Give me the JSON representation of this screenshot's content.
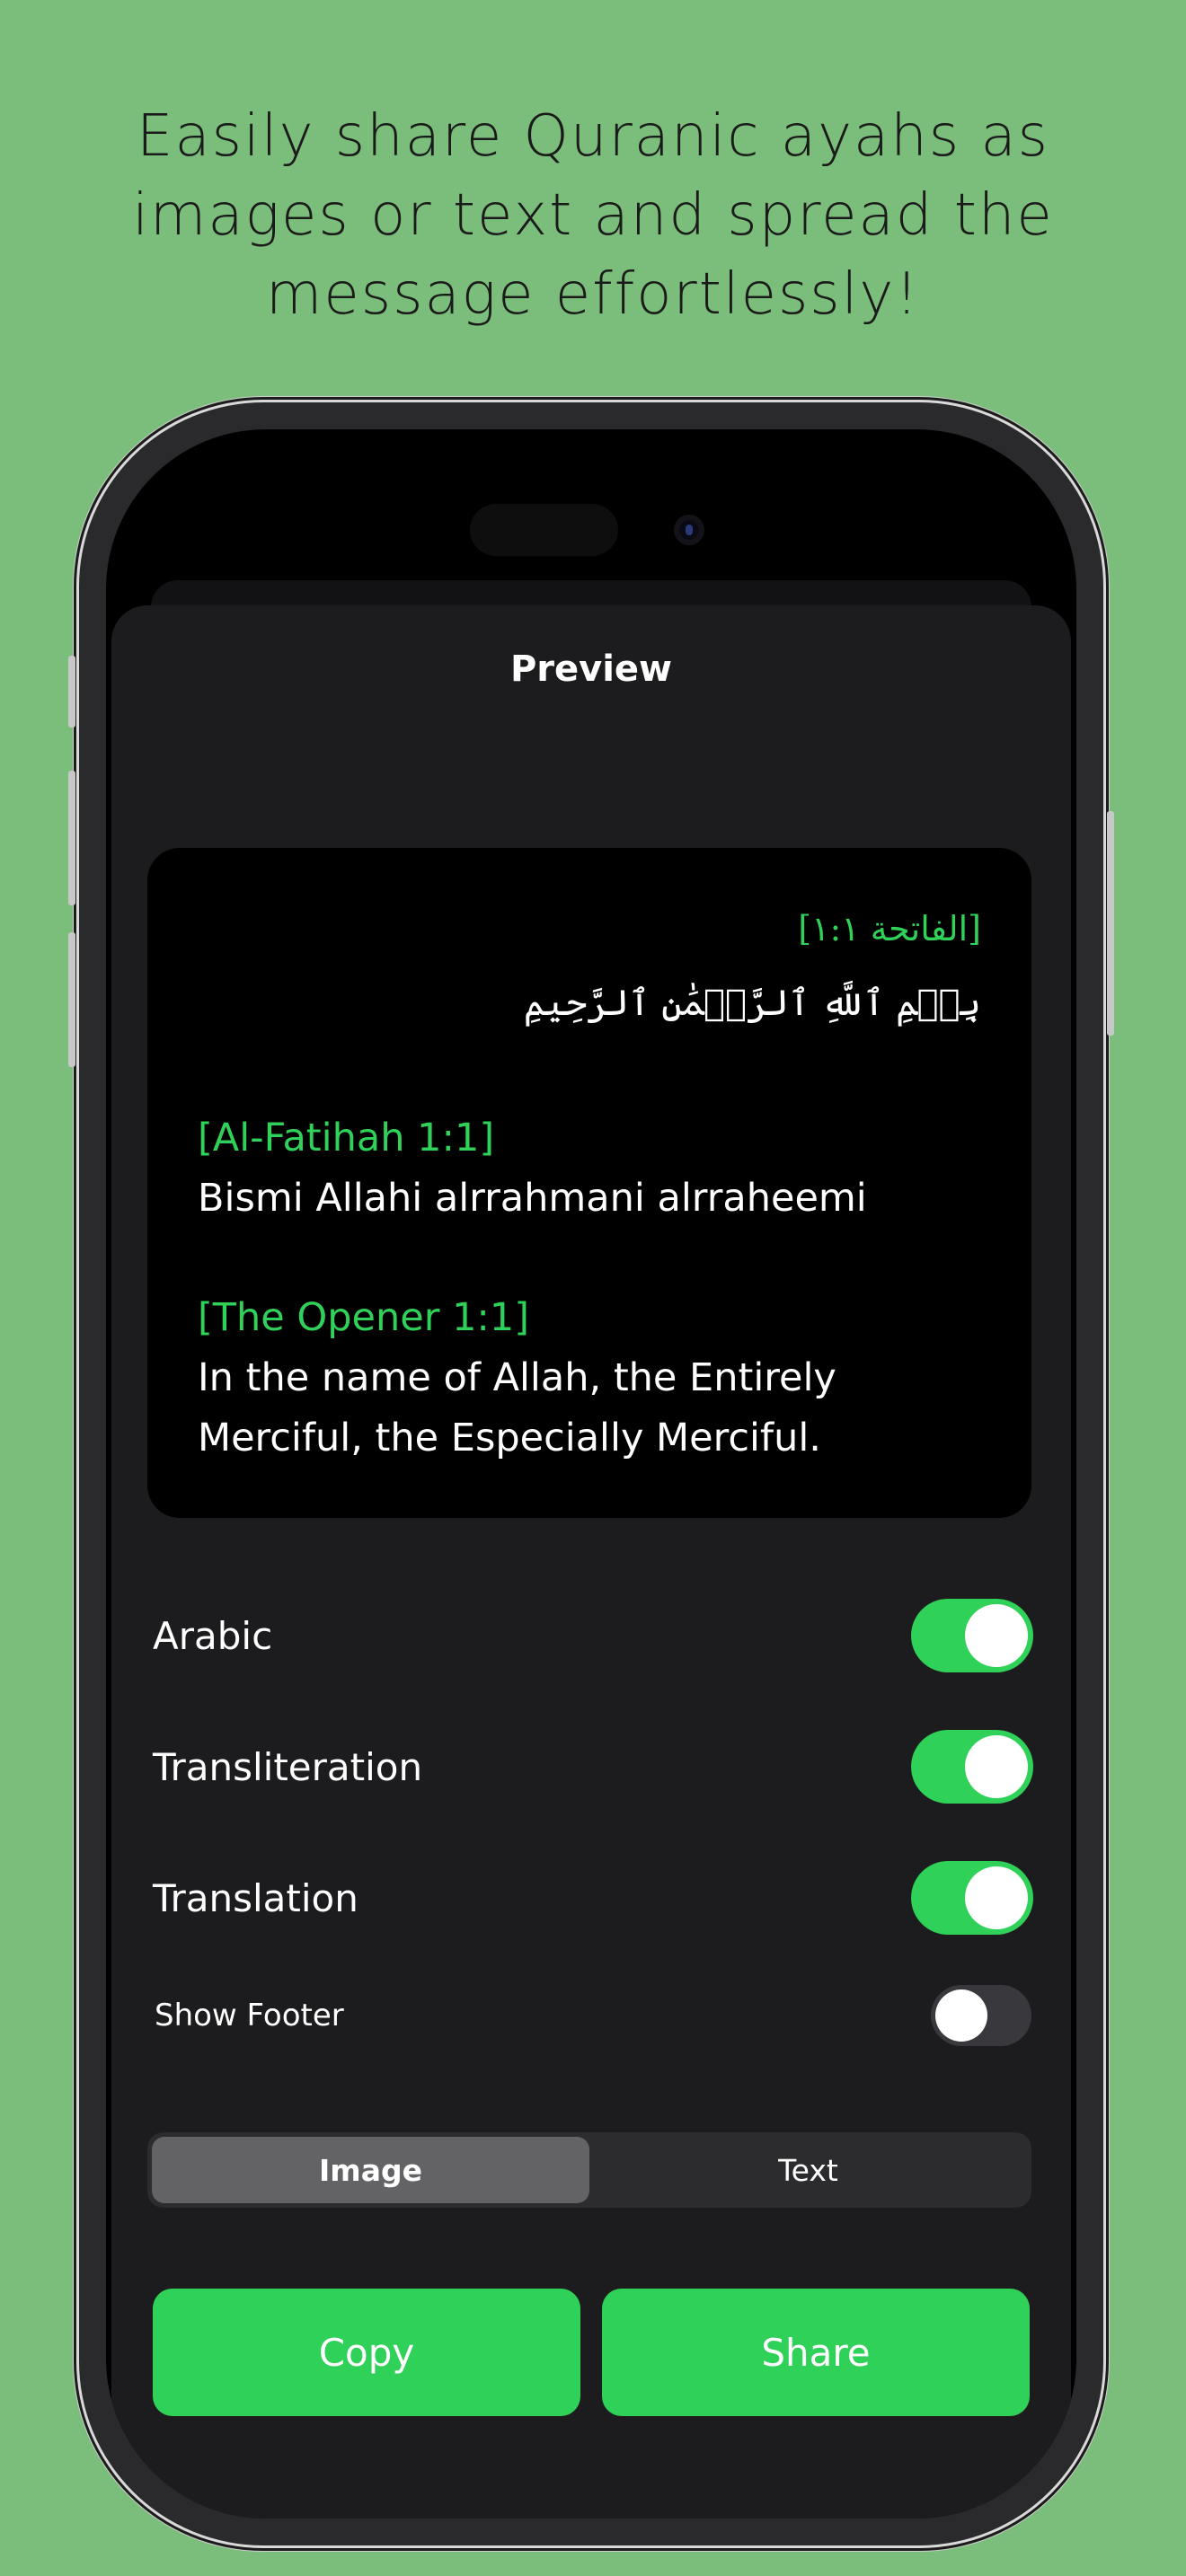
{
  "headline": {
    "line1": "Easily share Quranic ayahs as",
    "line2": "images or text and spread the",
    "line3": "message effortlessly!"
  },
  "sheet": {
    "title": "Preview"
  },
  "preview": {
    "arabic_ref": "[الفاتحة ١:١]",
    "arabic_text": "بِسۡمِ ٱللَّهِ ٱلرَّحۡمَٰنِ ٱلرَّحِيمِ",
    "transliteration_ref": "[Al-Fatihah 1:1]",
    "transliteration_text": "Bismi Allahi alrrahmani alrraheemi",
    "translation_ref": "[The Opener 1:1]",
    "translation_text": "In the name of Allah, the Entirely Merciful, the Especially Merciful."
  },
  "options": [
    {
      "label": "Arabic",
      "on": true
    },
    {
      "label": "Transliteration",
      "on": true
    },
    {
      "label": "Translation",
      "on": true
    },
    {
      "label": "Show Footer",
      "on": false
    }
  ],
  "format_segment": {
    "options": [
      "Image",
      "Text"
    ],
    "selected": "Image"
  },
  "actions": {
    "copy_label": "Copy",
    "share_label": "Share"
  },
  "colors": {
    "background": "#7BBD7A",
    "accent": "#30D158",
    "sheet": "#1C1C1E"
  }
}
